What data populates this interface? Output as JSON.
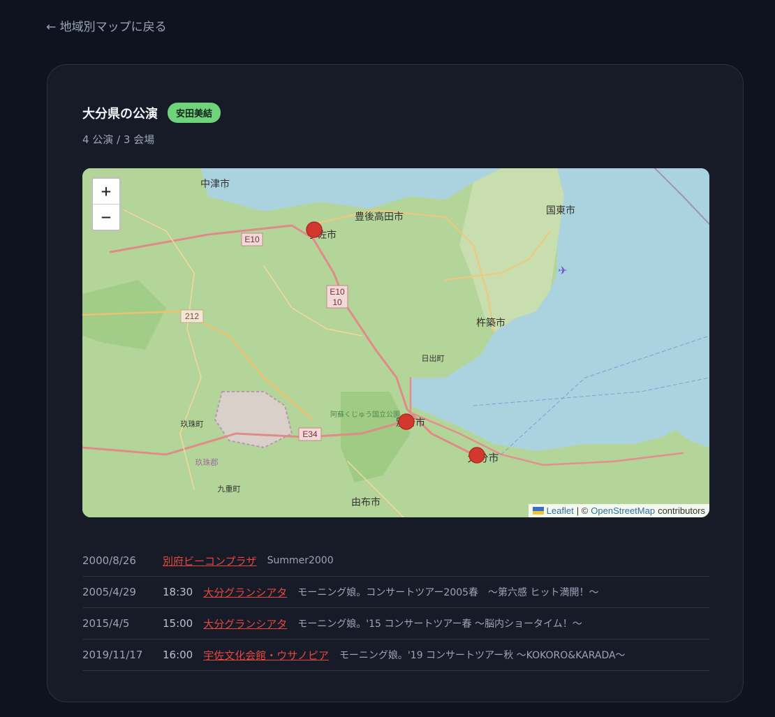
{
  "back_link": "← 地域別マップに戻る",
  "header": {
    "title": "大分県の公演",
    "badge": "安田美結",
    "summary": "4 公演 / 3 会場"
  },
  "map": {
    "zoom_in": "+",
    "zoom_out": "−",
    "attribution": {
      "leaflet": "Leaflet",
      "separator": "| ©",
      "osm": "OpenStreetMap",
      "suffix": "contributors"
    },
    "labels": {
      "nakatsu": "中津市",
      "bungotakada": "豊後高田市",
      "kunisaki": "国東市",
      "usa": "宇佐市",
      "kitsuki": "杵築市",
      "hiji": "日出町",
      "beppu": "別府市",
      "oita": "大分市",
      "yufu": "由布市",
      "kusu": "玖珠町",
      "kusu_gun": "玖珠郡",
      "kokonoe": "九重町",
      "park": "阿蘇くじゅう国立公園",
      "e10a": "E10",
      "e10b": "E10",
      "r10": "10",
      "r212": "212",
      "e34": "E34"
    }
  },
  "performances": [
    {
      "date": "2000/8/26",
      "time": "",
      "venue": "別府ビーコンプラザ",
      "name": "Summer2000"
    },
    {
      "date": "2005/4/29",
      "time": "18:30",
      "venue": "大分グランシアタ",
      "name": "モーニング娘。コンサートツアー2005春　～第六感 ヒット満開！～"
    },
    {
      "date": "2015/4/5",
      "time": "15:00",
      "venue": "大分グランシアタ",
      "name": "モーニング娘。'15 コンサートツアー春 ～脳内ショータイム！～"
    },
    {
      "date": "2019/11/17",
      "time": "16:00",
      "venue": "宇佐文化会館・ウサノピア",
      "name": "モーニング娘。'19 コンサートツアー秋 ～KOKORO&KARADA～"
    }
  ],
  "colors": {
    "accent_link": "#e5473e",
    "badge_bg": "#6fd37c",
    "marker": "#d2382f"
  }
}
